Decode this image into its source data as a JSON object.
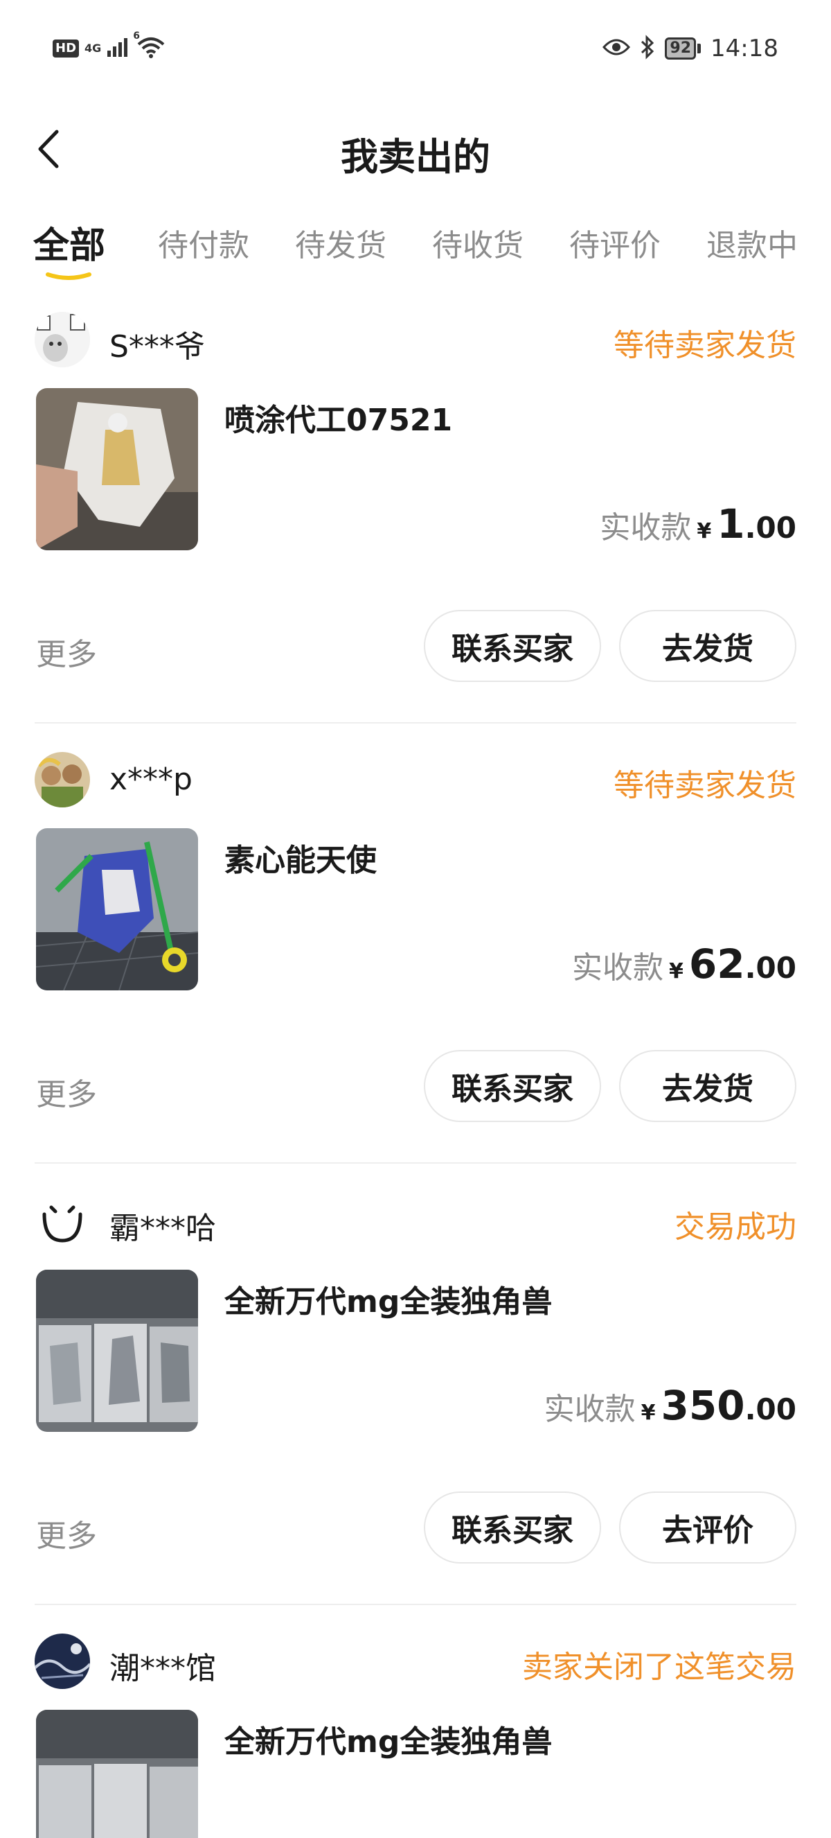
{
  "status_bar": {
    "hd": "HD",
    "network": "4G",
    "wifi_tag": "6",
    "battery": "92",
    "time": "14:18"
  },
  "nav": {
    "title": "我卖出的"
  },
  "tabs": [
    {
      "label": "全部"
    },
    {
      "label": "待付款"
    },
    {
      "label": "待发货"
    },
    {
      "label": "待收货"
    },
    {
      "label": "待评价"
    },
    {
      "label": "退款中"
    }
  ],
  "orders": [
    {
      "buyer": "S***爷",
      "status": "等待卖家发货",
      "title": "喷涂代工07521",
      "price_label": "实收款",
      "currency": "¥",
      "price_int": "1",
      "price_dec": ".00",
      "more": "更多",
      "contact_label": "联系买家",
      "action_label": "去发货"
    },
    {
      "buyer": "x***p",
      "status": "等待卖家发货",
      "title": "素心能天使",
      "price_label": "实收款",
      "currency": "¥",
      "price_int": "62",
      "price_dec": ".00",
      "more": "更多",
      "contact_label": "联系买家",
      "action_label": "去发货"
    },
    {
      "buyer": "霸***哈",
      "status": "交易成功",
      "title": "全新万代mg全装独角兽",
      "price_label": "实收款",
      "currency": "¥",
      "price_int": "350",
      "price_dec": ".00",
      "more": "更多",
      "contact_label": "联系买家",
      "action_label": "去评价"
    },
    {
      "buyer": "潮***馆",
      "status": "卖家关闭了这笔交易",
      "title": "全新万代mg全装独角兽"
    }
  ],
  "colors": {
    "accent_orange": "#f0902a",
    "tab_underline": "#f5c518",
    "text_primary": "#1a1a1a",
    "text_secondary": "#8c8c8c"
  }
}
